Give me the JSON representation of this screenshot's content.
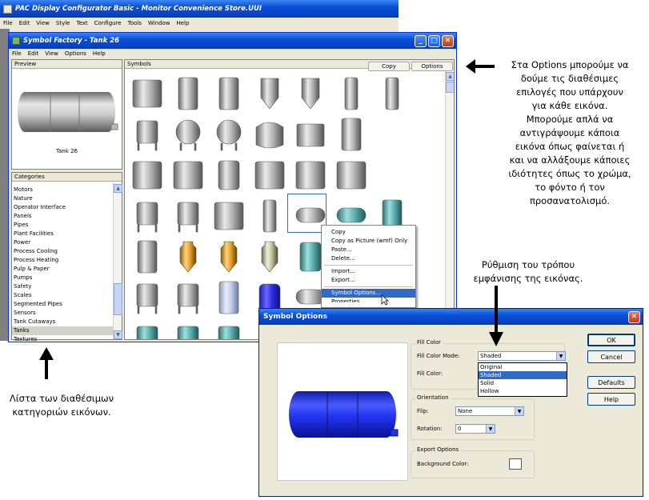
{
  "outer_window": {
    "title": "PAC Display Configurator Basic - Monitor Convenience Store.UUI",
    "menu": [
      "File",
      "Edit",
      "View",
      "Style",
      "Text",
      "Configure",
      "Tools",
      "Window",
      "Help"
    ]
  },
  "symbol_factory": {
    "title": "Symbol Factory - Tank 26",
    "menu": [
      "File",
      "Edit",
      "View",
      "Options",
      "Help"
    ],
    "preview_header": "Preview",
    "preview_caption": "Tank 26",
    "categories_header": "Categories",
    "categories": [
      "Motors",
      "Nature",
      "Operator Interface",
      "Panels",
      "Pipes",
      "Plant Facilities",
      "Power",
      "Process Cooling",
      "Process Heating",
      "Pulp & Paper",
      "Pumps",
      "Safety",
      "Scales",
      "Segmented Pipes",
      "Sensors",
      "Tank Cutaways",
      "Tanks",
      "Textures"
    ],
    "selected_category": "Tanks",
    "symbols_header": "Symbols",
    "copy_button": "Copy",
    "options_button": "Options"
  },
  "context_menu": {
    "items": [
      "Copy",
      "Copy as Picture (wmf) Only",
      "Paste...",
      "Delete..."
    ],
    "items2": [
      "Import...",
      "Export..."
    ],
    "highlighted": "Symbol Options...",
    "partial": "Properties"
  },
  "symbol_options": {
    "title": "Symbol Options",
    "fill_color_group": "Fill Color",
    "fill_color_mode_label": "Fill Color Mode:",
    "fill_color_mode_value": "Shaded",
    "fill_color_label": "Fill Color:",
    "mode_options": [
      "Original",
      "Shaded",
      "Solid",
      "Hollow"
    ],
    "orientation_group": "Orientation",
    "flip_label": "Flip:",
    "flip_value": "None",
    "rotation_label": "Rotation:",
    "rotation_value": "0",
    "export_group": "Export Options",
    "background_color_label": "Background Color:",
    "ok": "OK",
    "cancel": "Cancel",
    "defaults": "Defaults",
    "help": "Help",
    "preview_color": "#2233ee"
  },
  "annotations": {
    "options_note": [
      "Στα Options μπορούμε να",
      "δούμε τις διαθέσιμες",
      "επιλογές που υπάρχουν",
      "για κάθε εικόνα.",
      "Μπορούμε απλά να",
      "αντιγράψουμε κάποια",
      "εικόνα όπως φαίνεται ή",
      "και να αλλάξουμε κάποιες",
      "ιδιότητες όπως το χρώμα,",
      "το φόντο ή τον",
      "προσανατολισμό."
    ],
    "display_note": [
      "Ρύθμιση του τρόπου",
      "εμφάνισης της εικόνας."
    ],
    "categories_note": [
      "Λίστα των διαθέσιμων",
      "κατηγοριών εικόνων."
    ]
  }
}
